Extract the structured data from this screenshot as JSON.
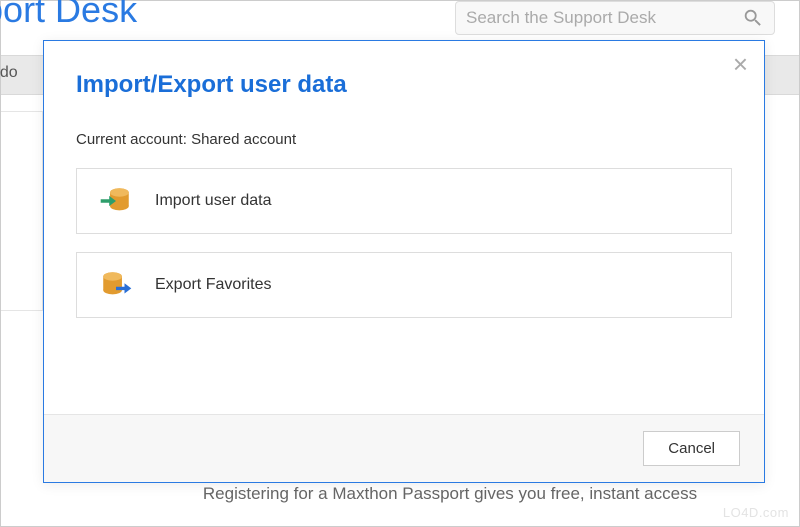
{
  "background": {
    "title_fragment": "pport Desk",
    "search_placeholder": "Search the Support Desk",
    "tab_fragment": "ndo",
    "bottom_text": "Registering for a Maxthon Passport gives you free, instant access",
    "watermark": "LO4D.com"
  },
  "modal": {
    "title": "Import/Export user data",
    "account_label": "Current account:",
    "account_value": "Shared account",
    "options": {
      "import": "Import user data",
      "export": "Export Favorites"
    },
    "cancel": "Cancel"
  }
}
